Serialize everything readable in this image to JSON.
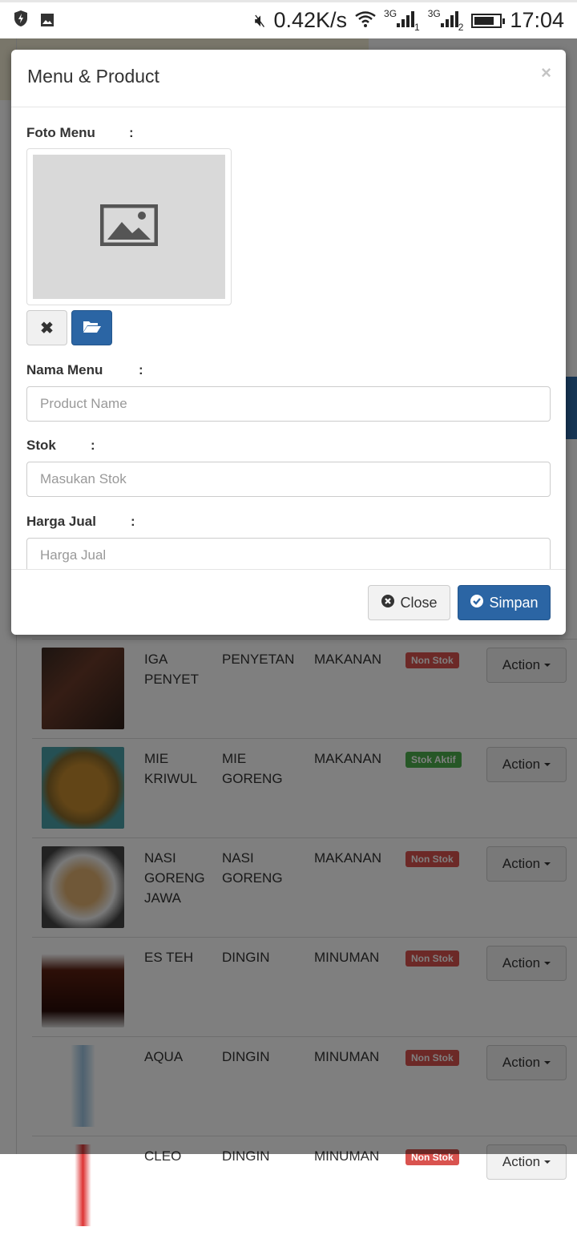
{
  "status_bar": {
    "speed": "0.42K/s",
    "net1": "3G",
    "sim1": "1",
    "net2": "3G",
    "sim2": "2",
    "time": "17:04",
    "battery_percent": 80
  },
  "modal": {
    "title": "Menu & Product",
    "close_symbol": "×",
    "fields": {
      "photo_label": "Foto Menu",
      "name_label": "Nama Menu",
      "name_placeholder": "Product Name",
      "stock_label": "Stok",
      "stock_placeholder": "Masukan Stok",
      "price_label": "Harga Jual",
      "price_placeholder": "Harga Jual",
      "colon": ":"
    },
    "footer": {
      "close_label": "Close",
      "save_label": "Simpan"
    }
  },
  "colors": {
    "primary": "#2b65a4",
    "danger": "#d9534f",
    "success": "#4cae4c"
  },
  "table": {
    "action_label": "Action",
    "rows": [
      {
        "name": "IGA PENYET",
        "category": "PENYETAN",
        "type": "MAKANAN",
        "status": "Non Stok",
        "status_type": "danger",
        "image": "grilled-ribs"
      },
      {
        "name": "MIE KRIWUL",
        "category": "MIE GORENG",
        "type": "MAKANAN",
        "status": "Stok Aktif",
        "status_type": "success",
        "image": "fried-noodles"
      },
      {
        "name": "NASI GORENG JAWA",
        "category": "NASI GORENG",
        "type": "MAKANAN",
        "status": "Non Stok",
        "status_type": "danger",
        "image": "fried-rice"
      },
      {
        "name": "ES TEH",
        "category": "DINGIN",
        "type": "MINUMAN",
        "status": "Non Stok",
        "status_type": "danger",
        "image": "iced-tea"
      },
      {
        "name": "AQUA",
        "category": "DINGIN",
        "type": "MINUMAN",
        "status": "Non Stok",
        "status_type": "danger",
        "image": "water-bottle"
      },
      {
        "name": "CLEO",
        "category": "DINGIN",
        "type": "MINUMAN",
        "status": "Non Stok",
        "status_type": "danger",
        "image": "bottle"
      }
    ]
  }
}
